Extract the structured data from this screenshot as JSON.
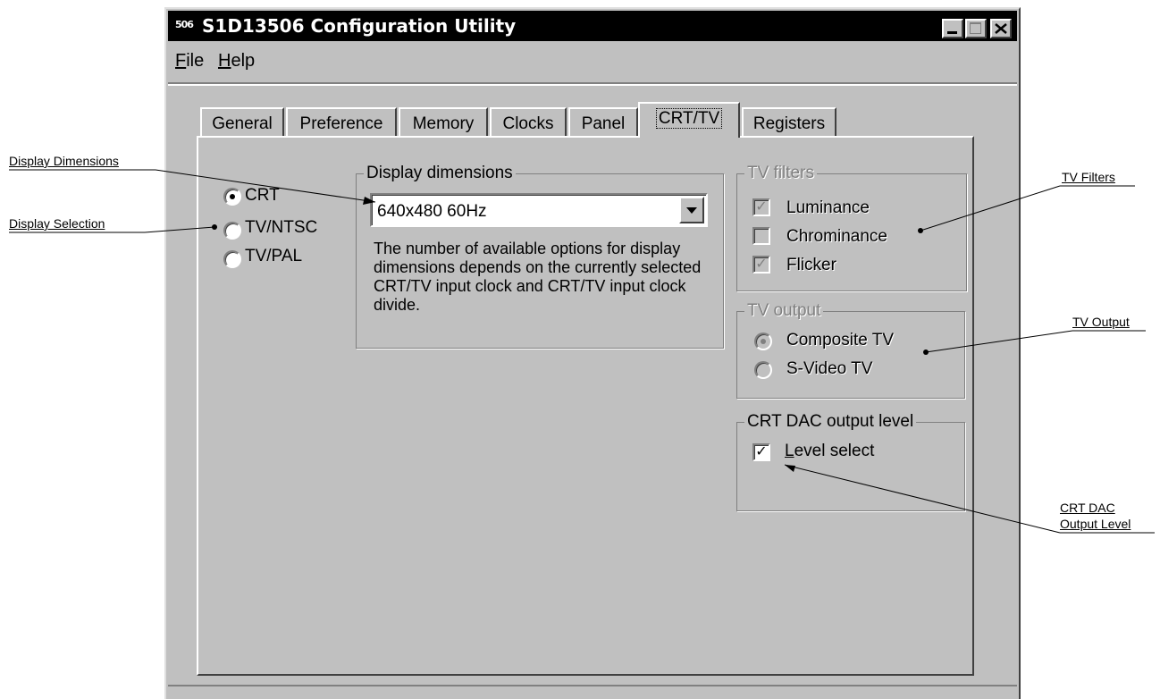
{
  "window": {
    "title": "S1D13506 Configuration Utility",
    "icon_text": "506"
  },
  "menu": {
    "file_first": "F",
    "file_rest": "ile",
    "help_first": "H",
    "help_rest": "elp"
  },
  "tabs": [
    "General",
    "Preference",
    "Memory",
    "Clocks",
    "Panel",
    "CRT/TV",
    "Registers"
  ],
  "selected_tab": "CRT/TV",
  "display_selection": {
    "options": [
      "CRT",
      "TV/NTSC",
      "TV/PAL"
    ],
    "selected": "CRT"
  },
  "display_dimensions": {
    "group_title": "Display dimensions",
    "value": "640x480 60Hz",
    "description": "The number of available options for display dimensions depends on the currently selected CRT/TV input clock and CRT/TV input clock divide."
  },
  "tv_filters": {
    "group_title": "TV filters",
    "items": [
      {
        "label": "Luminance",
        "checked": true
      },
      {
        "label": "Chrominance",
        "checked": false
      },
      {
        "label": "Flicker",
        "checked": true
      }
    ],
    "enabled": false
  },
  "tv_output": {
    "group_title": "TV output",
    "options": [
      "Composite TV",
      "S-Video TV"
    ],
    "selected": "Composite TV",
    "enabled": false
  },
  "crt_dac": {
    "group_title": "CRT DAC output level",
    "level_first": "L",
    "level_rest": "evel select",
    "checked": true
  },
  "callouts": {
    "display_dimensions": "Display Dimensions",
    "display_selection": "Display Selection",
    "tv_filters": "TV Filters",
    "tv_output": "TV Output",
    "crt_dac_line1": "CRT DAC",
    "crt_dac_line2": "Output Level"
  },
  "colors": {
    "face": "#c0c0c0",
    "title_bar": "#000000",
    "disabled_text": "#808080"
  }
}
